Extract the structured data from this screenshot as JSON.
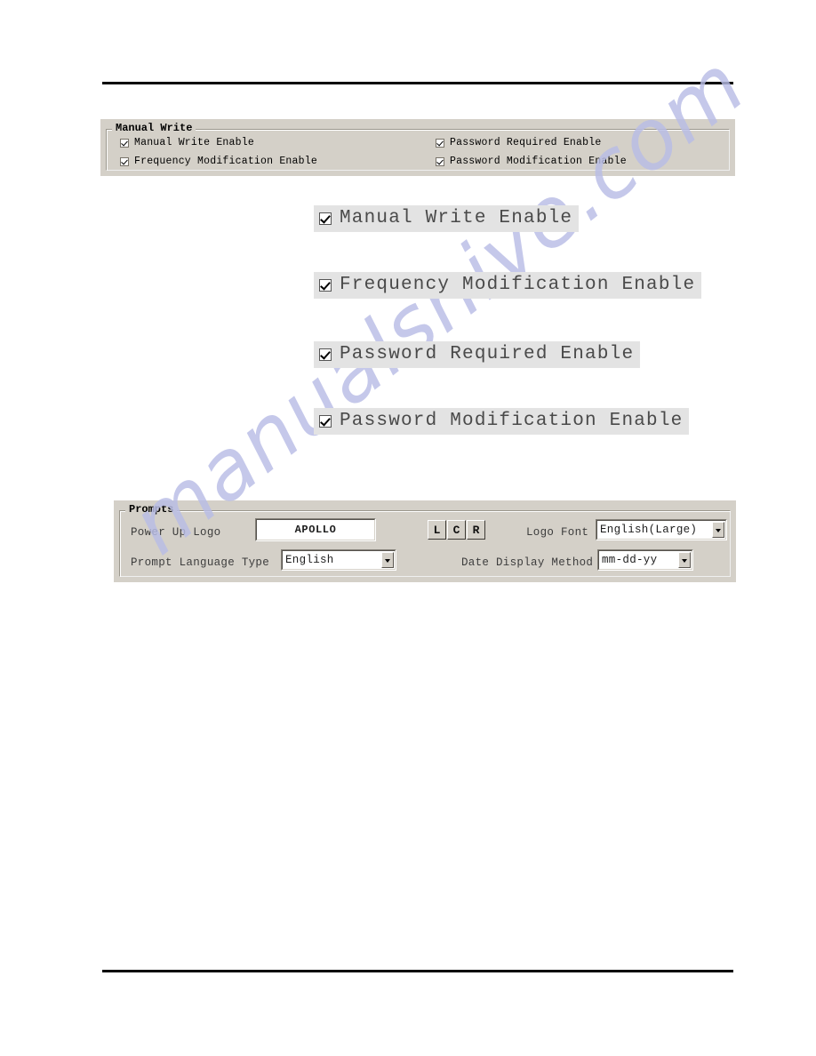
{
  "page": {
    "background_color": "#ffffff",
    "rule_color": "#000000"
  },
  "watermark": {
    "text": "manualshive.com",
    "color": "#b9bde6"
  },
  "manual_write_group": {
    "title": "Manual Write",
    "background_color": "#d4d0c8",
    "checkboxes": [
      {
        "label": "Manual Write Enable",
        "checked": true
      },
      {
        "label": "Frequency Modification Enable",
        "checked": true
      },
      {
        "label": "Password Required Enable",
        "checked": true
      },
      {
        "label": "Password Modification Enable",
        "checked": true
      }
    ]
  },
  "callouts": [
    {
      "label": "Manual Write Enable",
      "checked": true
    },
    {
      "label": "Frequency Modification Enable",
      "checked": true
    },
    {
      "label": "Password Required Enable",
      "checked": true
    },
    {
      "label": "Password Modification Enable",
      "checked": true
    }
  ],
  "prompts_group": {
    "title": "Prompts",
    "background_color": "#d4d0c8",
    "power_up_logo": {
      "label": "Power Up Logo",
      "value": "APOLLO"
    },
    "alignment_buttons": [
      {
        "label": "L",
        "name": "align-left"
      },
      {
        "label": "C",
        "name": "align-center"
      },
      {
        "label": "R",
        "name": "align-right"
      }
    ],
    "logo_font": {
      "label": "Logo Font",
      "value": "English(Large)"
    },
    "prompt_language_type": {
      "label": "Prompt Language Type",
      "value": "English"
    },
    "date_display_method": {
      "label": "Date Display Method",
      "value": "mm-dd-yy"
    }
  }
}
